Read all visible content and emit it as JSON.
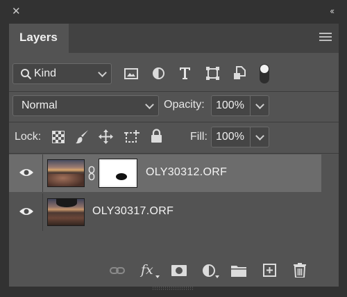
{
  "window": {
    "close_glyph": "✕",
    "collapse_glyph": "‹‹"
  },
  "panel": {
    "tab_label": "Layers",
    "menu_icon": "hamburger-menu-icon"
  },
  "filter": {
    "kind_label": "Kind",
    "icons": [
      "image-filter-icon",
      "adjustment-filter-icon",
      "type-filter-icon",
      "shape-filter-icon",
      "smart-object-filter-icon",
      "filter-toggle-icon"
    ]
  },
  "blend": {
    "mode": "Normal",
    "opacity_label": "Opacity:",
    "opacity_value": "100%"
  },
  "lock": {
    "label": "Lock:",
    "icons": [
      "lock-transparent-pixels-icon",
      "lock-image-pixels-icon",
      "lock-position-icon",
      "prevent-auto-nesting-icon",
      "lock-all-icon"
    ],
    "fill_label": "Fill:",
    "fill_value": "100%"
  },
  "layers": [
    {
      "name": "OLY30312.ORF",
      "visible": true,
      "selected": true,
      "has_mask": true
    },
    {
      "name": "OLY30317.ORF",
      "visible": true,
      "selected": false,
      "has_mask": false
    }
  ],
  "footer": {
    "icons": [
      "link-layers-icon",
      "layer-style-icon",
      "add-mask-icon",
      "new-adjustment-layer-icon",
      "new-group-icon",
      "new-layer-icon",
      "delete-layer-icon"
    ],
    "fx_label": "fx"
  },
  "colors": {
    "panel_bg": "#535353",
    "selected_row": "#6c6c6c",
    "frame_bg": "#323232"
  }
}
